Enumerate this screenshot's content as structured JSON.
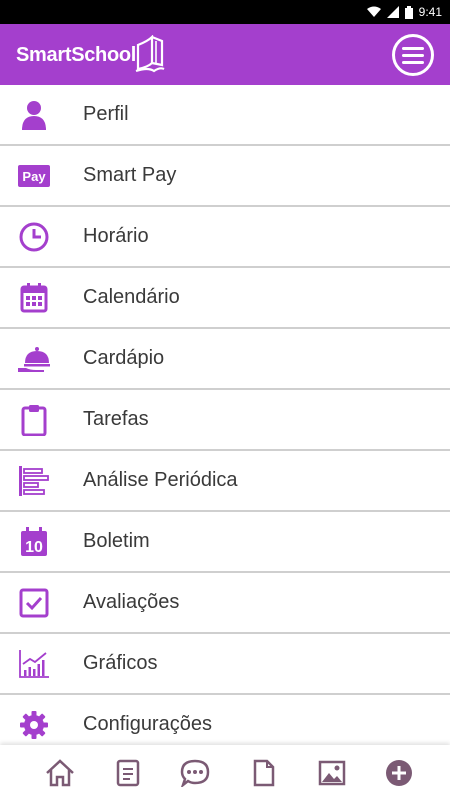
{
  "status_bar": {
    "time": "9:41"
  },
  "app_bar": {
    "logo_text": "SmartSchool"
  },
  "accent_color": "#a43fcd",
  "nav_icon_color": "#7b5a74",
  "menu_items": [
    {
      "label": "Perfil",
      "icon": "person-icon"
    },
    {
      "label": "Smart Pay",
      "icon": "pay-icon",
      "icon_text": "Pay"
    },
    {
      "label": "Horário",
      "icon": "clock-icon"
    },
    {
      "label": "Calendário",
      "icon": "calendar-icon"
    },
    {
      "label": "Cardápio",
      "icon": "food-tray-icon"
    },
    {
      "label": "Tarefas",
      "icon": "clipboard-icon"
    },
    {
      "label": "Análise Periódica",
      "icon": "bar-list-icon"
    },
    {
      "label": "Boletim",
      "icon": "calendar-number-icon",
      "icon_text": "10"
    },
    {
      "label": "Avaliações",
      "icon": "checkbox-icon"
    },
    {
      "label": "Gráficos",
      "icon": "line-chart-icon"
    },
    {
      "label": "Configurações",
      "icon": "gear-icon"
    }
  ],
  "bottom_nav": [
    "home-icon",
    "notes-icon",
    "chat-icon",
    "document-icon",
    "image-icon",
    "add-icon"
  ]
}
